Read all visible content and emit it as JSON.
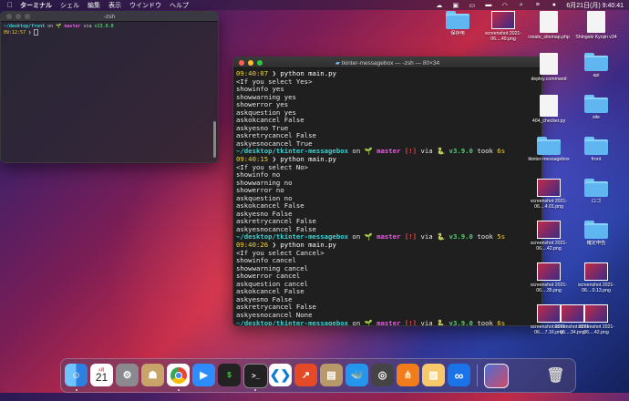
{
  "menubar": {
    "app_name": "ターミナル",
    "items": [
      "シェル",
      "編集",
      "表示",
      "ウインドウ",
      "ヘルプ"
    ],
    "clock": "6月21日(月) 9:40:41"
  },
  "small_terminal": {
    "title": "-zsh",
    "prompt_path": "~/desktop/front",
    "on": "on",
    "branch_label": "master",
    "via": "via",
    "node_version": "v13.9.0",
    "time": "09:12:57",
    "prompt_char": "❯"
  },
  "main_terminal": {
    "title": "tkinter-messagebox — -zsh — 80×34",
    "blocks": [
      {
        "time": "09:40:07",
        "command": "python main.py",
        "output": [
          "<If you select Yes>",
          "showinfo yes",
          "showwarning yes",
          "showerror yes",
          "askquestion yes",
          "askokcancel False",
          "askyesno True",
          "askretrycancel False",
          "askyesnocancel True"
        ],
        "took": "6s"
      },
      {
        "time": "09:40:15",
        "command": "python main.py",
        "output": [
          "<If you select No>",
          "showinfo no",
          "showwarning no",
          "showerror no",
          "askquestion no",
          "askokcancel False",
          "askyesno False",
          "askretrycancel False",
          "askyesnocancel False"
        ],
        "took": "5s"
      },
      {
        "time": "09:40:26",
        "command": "python main.py",
        "output": [
          "<If you select Cancel>",
          "showinfo cancel",
          "showwarning cancel",
          "showerror cancel",
          "askquestion cancel",
          "askokcancel False",
          "askyesno False",
          "askretrycancel False",
          "askyesnocancel None"
        ],
        "took": "6s"
      }
    ],
    "status": {
      "path": "~/desktop/tkinter-messagebox",
      "on": "on",
      "branch": "master",
      "dirty": "[!]",
      "via": "via",
      "python": "v3.9.0",
      "took_word": "took"
    },
    "final_time": "09:40:39",
    "prompt_char": "❯"
  },
  "desktop_icons": [
    {
      "label": "保存用",
      "kind": "folder"
    },
    {
      "label": "screenshot 2021-06....49.png",
      "kind": "shot"
    },
    {
      "label": "create_sitemap.php",
      "kind": "doc"
    },
    {
      "label": "Shingeki Kyojin v34",
      "kind": "doc"
    },
    {
      "label": "deploy.command",
      "kind": "doc"
    },
    {
      "label": "api",
      "kind": "folder"
    },
    {
      "label": "404_checker.py",
      "kind": "doc"
    },
    {
      "label": "site",
      "kind": "folder"
    },
    {
      "label": "tkinter-messagebox",
      "kind": "folder"
    },
    {
      "label": "front",
      "kind": "folder"
    },
    {
      "label": "screenshot 2021-06....4.01.png",
      "kind": "shot"
    },
    {
      "label": "ロゴ",
      "kind": "folder"
    },
    {
      "label": "screenshot 2021-06....42.png",
      "kind": "shot"
    },
    {
      "label": "確定申告",
      "kind": "folder"
    },
    {
      "label": "screenshot 2021-06....35.png",
      "kind": "shot"
    },
    {
      "label": "screenshot 2021-06....0.13.png",
      "kind": "shot"
    },
    {
      "label": "screenshot 2021-06....7.16.png",
      "kind": "shot"
    },
    {
      "label": "screenshot 2021-06....34.png",
      "kind": "shot"
    },
    {
      "label": "screenshot 2021-06....42.png",
      "kind": "shot"
    }
  ],
  "dock": {
    "calendar_month": "6月",
    "calendar_day": "21"
  }
}
